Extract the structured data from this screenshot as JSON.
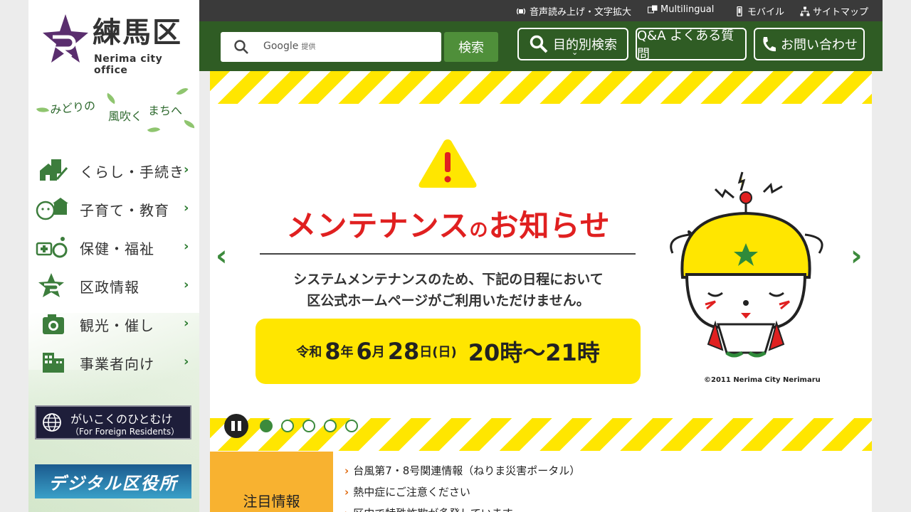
{
  "logo": {
    "ja": "練馬区",
    "en": "Nerima city office"
  },
  "slogan": {
    "part1": "みどりの",
    "part2": "風吹く",
    "part3": "まちへ"
  },
  "nav": {
    "items": [
      {
        "label": "くらし・手続き",
        "icon": "house-pen-icon"
      },
      {
        "label": "子育て・教育",
        "icon": "child-school-icon"
      },
      {
        "label": "保健・福祉",
        "icon": "medical-wheelchair-icon"
      },
      {
        "label": "区政情報",
        "icon": "nerima-star-icon"
      },
      {
        "label": "観光・催し",
        "icon": "camera-icon"
      },
      {
        "label": "事業者向け",
        "icon": "building-icon"
      }
    ]
  },
  "banners": {
    "foreign_line1": "がいこくのひとむけ",
    "foreign_line2": "（For Foreign Residents）",
    "digital": "デジタル区役所"
  },
  "utilbar": {
    "speech": "音声読み上げ・文字拡大",
    "multilingual": "Multilingual",
    "mobile": "モバイル",
    "sitemap": "サイトマップ"
  },
  "header": {
    "search_brand": "Google",
    "search_sub": "提供",
    "search_button": "検索",
    "purpose_search": "目的別検索",
    "faq": "Q&A よくある質問",
    "contact": "お問い合わせ"
  },
  "slide": {
    "title_a": "メンテナンス",
    "title_no": "の",
    "title_b": "お知らせ",
    "msg1": "システムメンテナンスのため、下記の日程において",
    "msg2": "区公式ホームページがご利用いただけません。",
    "date": {
      "era": "令和",
      "year": "8",
      "year_unit": "年",
      "month": "6",
      "month_unit": "月",
      "day": "28",
      "day_unit": "日",
      "weekday": "(日)",
      "time": "20時～21時"
    },
    "copyright": "©2011 Nerima City Nerimaru"
  },
  "carousel": {
    "slide_count": 5,
    "active_index": 0
  },
  "news": {
    "label": "注目情報",
    "items": [
      "台風第7・8号関連情報（ねりま災害ポータル）",
      "熱中症にご注意ください",
      "区内で特殊詐欺が多発しています"
    ]
  },
  "colors": {
    "header_green": "#2f5c24",
    "accent_green": "#3c8a3c",
    "stripe_yellow": "#ffe600",
    "notice_orange": "#f8b230",
    "title_red": "#e02020",
    "logo_purple": "#5a2e6e"
  }
}
